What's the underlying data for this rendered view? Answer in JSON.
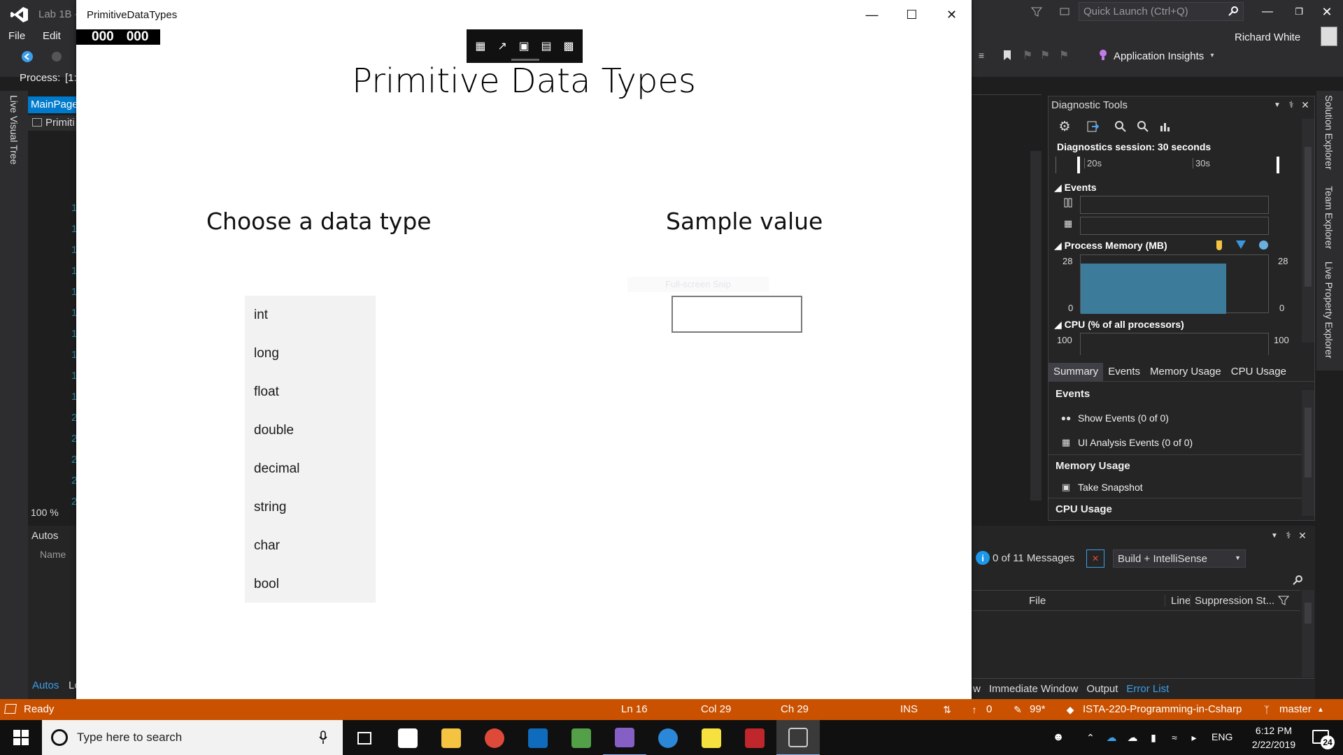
{
  "vs": {
    "project_label": "Lab 1B -",
    "menu": [
      "File",
      "Edit"
    ],
    "process_label": "Process:",
    "process_value": "[1:",
    "quick_launch_placeholder": "Quick Launch (Ctrl+Q)",
    "user_name": "Richard White",
    "app_insights": "Application Insights",
    "live_visual_tree": "Live Visual Tree",
    "doc_tab": "MainPage",
    "doc_subtab": "Primiti",
    "line_numbers": [
      "1",
      "1",
      "1",
      "1",
      "1",
      "1",
      "1",
      "1",
      "1",
      "1",
      "2",
      "2",
      "2",
      "2",
      "2"
    ],
    "zoom": "100 %",
    "autos_title": "Autos",
    "autos_col_name": "Name",
    "autos_bottom_tab": "Autos",
    "autos_bottom_tab2": "Lo",
    "right_side_tabs": [
      "Solution Explorer",
      "Team Explorer",
      "Live Property Explorer"
    ]
  },
  "diagnostics": {
    "title": "Diagnostic Tools",
    "session": "Diagnostics session: 30 seconds",
    "ticks": [
      "20s",
      "30s"
    ],
    "events_label": "Events",
    "memory_label": "Process Memory (MB)",
    "memory_max": "28",
    "memory_min": "0",
    "cpu_label": "CPU (% of all processors)",
    "cpu_max": "100",
    "tabs": [
      "Summary",
      "Events",
      "Memory Usage",
      "CPU Usage"
    ],
    "events_section": "Events",
    "show_events": "Show Events (0 of 0)",
    "ui_analysis_events": "UI Analysis Events (0 of 0)",
    "memory_section": "Memory Usage",
    "take_snapshot": "Take Snapshot",
    "cpu_section": "CPU Usage"
  },
  "error_list": {
    "messages": "0 of 11 Messages",
    "build_filter": "Build + IntelliSense",
    "col_file": "File",
    "col_line": "Line",
    "col_suppression": "Suppression St...",
    "bottom_tabs": [
      "w",
      "Immediate Window",
      "Output",
      "Error List"
    ]
  },
  "app": {
    "title": "PrimitiveDataTypes",
    "frame_counter_a": "000",
    "frame_counter_b": "000",
    "heading": "Primitive Data Types",
    "choose_label": "Choose a data type",
    "sample_label": "Sample value",
    "snip_hint": "Full-screen Snip",
    "types": [
      "int",
      "long",
      "float",
      "double",
      "decimal",
      "string",
      "char",
      "bool"
    ],
    "sample_value": ""
  },
  "status": {
    "ready": "Ready",
    "ln": "Ln 16",
    "col": "Col 29",
    "ch": "Ch 29",
    "ins": "INS",
    "push_count": "0",
    "pencil_count": "99*",
    "repo": "ISTA-220-Programming-in-Csharp",
    "branch": "master"
  },
  "taskbar": {
    "search_placeholder": "Type here to search",
    "lang": "ENG",
    "time": "6:12 PM",
    "date": "2/22/2019",
    "notif_count": "24"
  },
  "colors": {
    "vs_bg": "#2d2d30",
    "status_orange": "#ca5100",
    "accent_blue": "#007acc"
  }
}
